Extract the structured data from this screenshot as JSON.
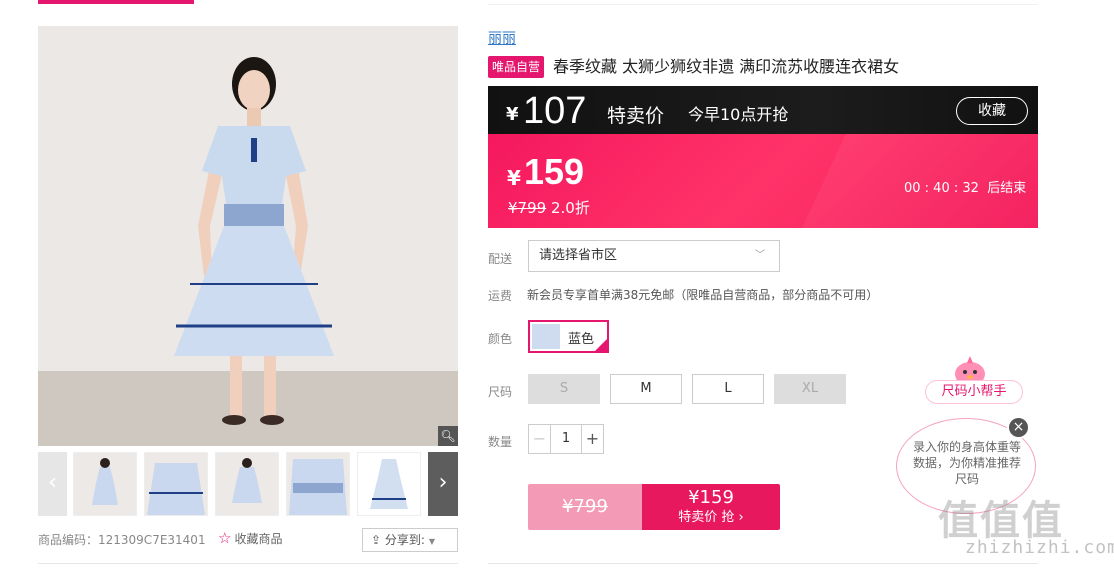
{
  "brand": "丽丽",
  "badge": "唯品自营",
  "title": "春季纹藏 太狮少狮纹非遗 满印流苏收腰连衣裙女",
  "flash": {
    "yen": "¥",
    "price": "107",
    "label": "特卖价",
    "time": "今早10点开抢",
    "collect": "收藏"
  },
  "sale": {
    "yen": "¥",
    "price": "159",
    "original": "¥799",
    "discount": "2.0折",
    "countdown": "00 : 40 : 32",
    "countdown_suffix": "后结束"
  },
  "delivery": {
    "label": "配送",
    "placeholder": "请选择省市区"
  },
  "freight": {
    "label": "运费",
    "text": "新会员专享首单满38元免邮（限唯品自营商品，部分商品不可用）"
  },
  "color": {
    "label": "颜色",
    "options": [
      {
        "name": "蓝色",
        "selected": true
      }
    ]
  },
  "size": {
    "label": "尺码",
    "options": [
      {
        "name": "S",
        "available": false
      },
      {
        "name": "M",
        "available": true
      },
      {
        "name": "L",
        "available": true
      },
      {
        "name": "XL",
        "available": false
      }
    ]
  },
  "quantity": {
    "label": "数量",
    "minus": "−",
    "value": "1",
    "plus": "+"
  },
  "buy": {
    "original": "¥799",
    "price": "¥159",
    "label": "特卖价 抢 ›"
  },
  "sku": "商品编码：121309C7E31401",
  "favorite": "收藏商品",
  "share": "分享到:",
  "helper": {
    "tag": "尺码小帮手",
    "text": "录入你的身高体重等数据，为你精准推荐尺码",
    "close": "×"
  },
  "watermark": {
    "main": "值值值",
    "sub": "zhizhizhi.com"
  },
  "colors": {
    "accent": "#e5166e",
    "sale": "#f5185f",
    "flash_bg": "#111111",
    "brand_link": "#2f78c8"
  }
}
